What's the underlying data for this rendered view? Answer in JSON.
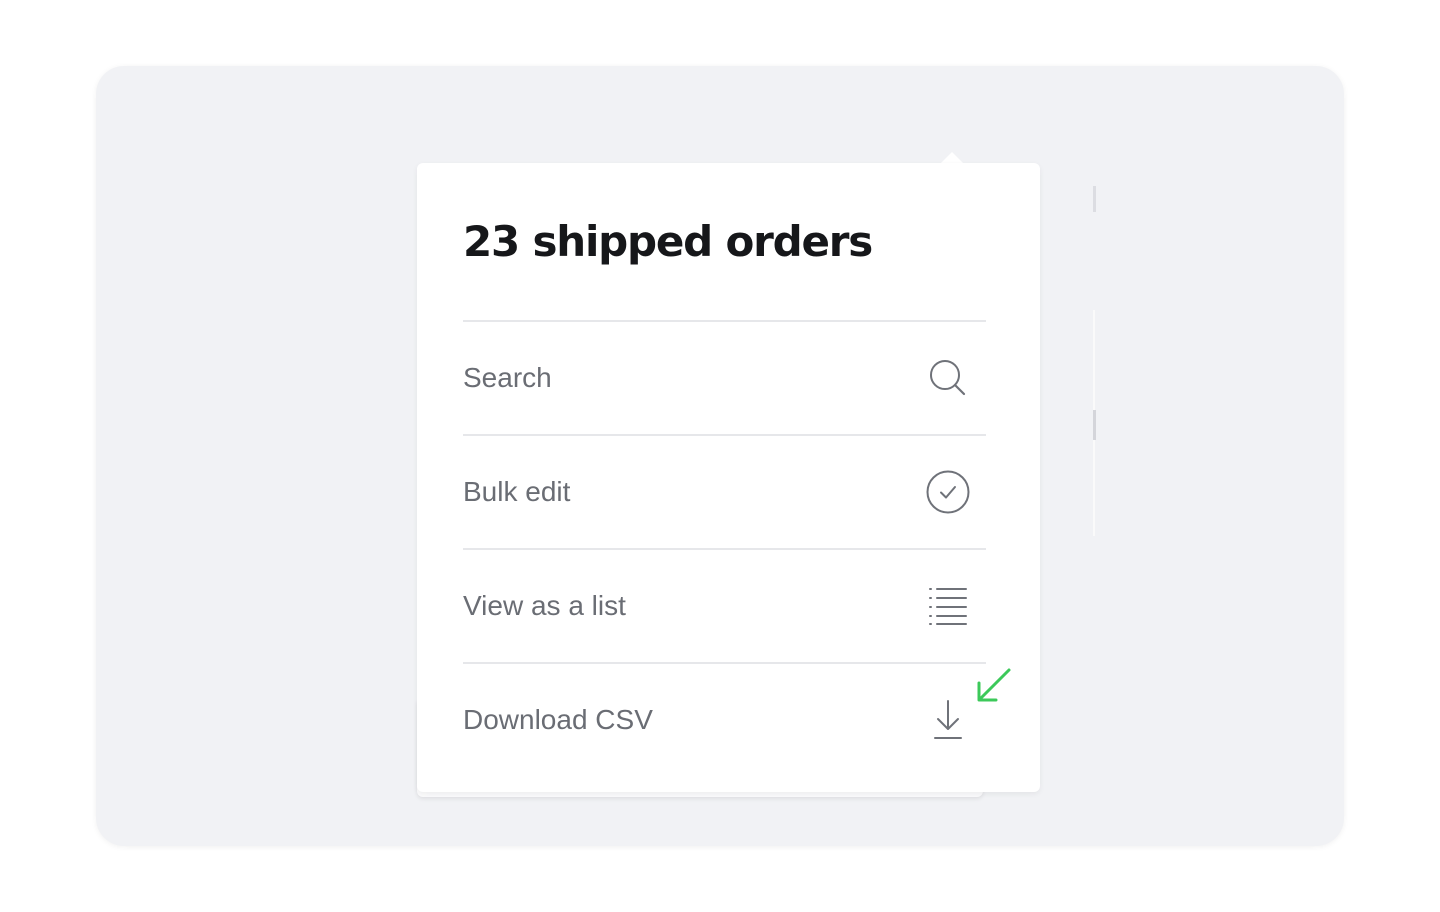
{
  "popover": {
    "title": "23 shipped orders",
    "items": [
      {
        "label": "Search",
        "icon": "search-icon"
      },
      {
        "label": "Bulk edit",
        "icon": "check-circle-icon"
      },
      {
        "label": "View as a list",
        "icon": "list-icon"
      },
      {
        "label": "Download CSV",
        "icon": "download-icon"
      }
    ]
  },
  "annotation": {
    "icon": "arrow-down-left-icon",
    "color": "#3cc95a"
  },
  "colors": {
    "frame_bg": "#f1f2f5",
    "title": "#16171a",
    "label": "#6a6d74",
    "icon": "#6f7279",
    "divider": "#e6e7ea"
  }
}
